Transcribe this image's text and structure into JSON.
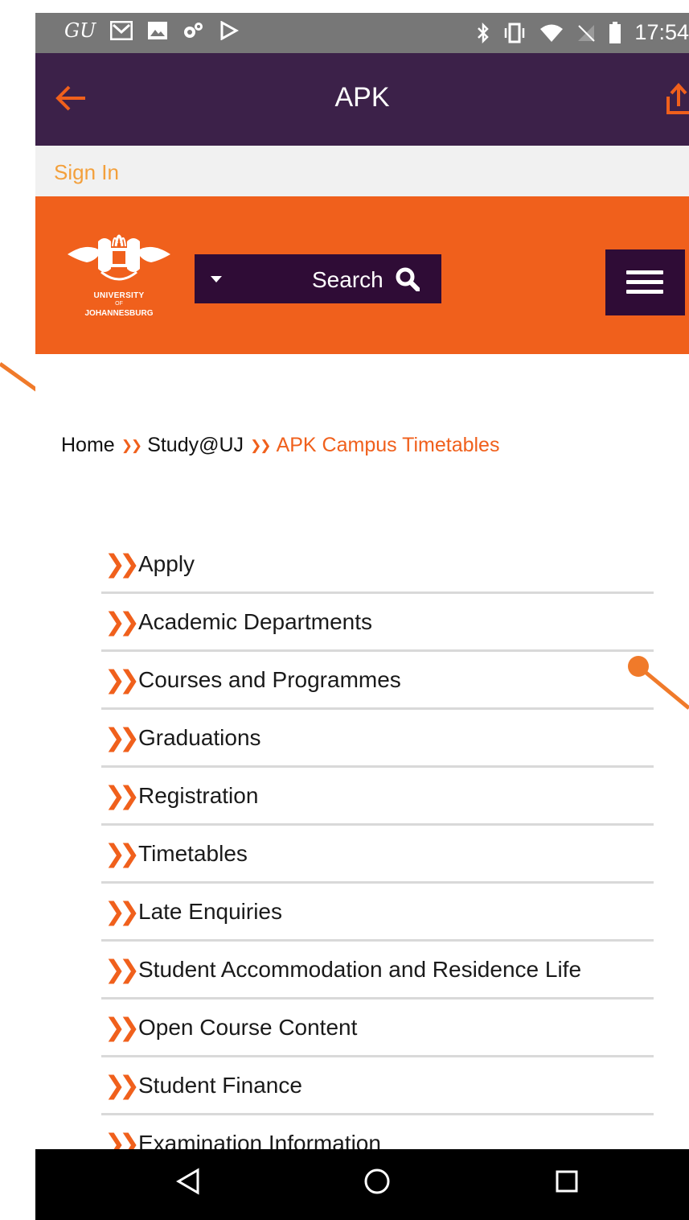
{
  "status_bar": {
    "carrier": "GU",
    "time": "17:54",
    "icons": [
      "gmail-icon",
      "gallery-icon",
      "settings-icon",
      "play-store-icon",
      "bluetooth-icon",
      "vibrate-icon",
      "wifi-icon",
      "no-sim-icon",
      "battery-icon"
    ]
  },
  "app_bar": {
    "title": "APK",
    "back_icon": "arrow-left-icon",
    "share_icon": "share-icon"
  },
  "sign_in": {
    "label": "Sign In"
  },
  "header": {
    "logo_line1": "UNIVERSITY",
    "logo_line2": "OF",
    "logo_line3": "JOHANNESBURG",
    "search_label": "Search",
    "search_icon": "search-icon",
    "menu_icon": "hamburger-icon"
  },
  "breadcrumb": {
    "home": "Home",
    "section": "Study@UJ",
    "current": "APK Campus Timetables"
  },
  "menu": {
    "items": [
      {
        "label": "Apply"
      },
      {
        "label": "Academic Departments"
      },
      {
        "label": "Courses and Programmes"
      },
      {
        "label": "Graduations"
      },
      {
        "label": "Registration"
      },
      {
        "label": "Timetables"
      },
      {
        "label": "Late Enquiries"
      },
      {
        "label": "Student Accommodation and Residence Life"
      },
      {
        "label": "Open Course Content"
      },
      {
        "label": "Student Finance"
      },
      {
        "label": "Examination Information"
      }
    ]
  },
  "colors": {
    "app_bar": "#3c2149",
    "brand_orange": "#f0601c",
    "dark_purple": "#2f0c36",
    "sign_in_text": "#f3a03c"
  }
}
